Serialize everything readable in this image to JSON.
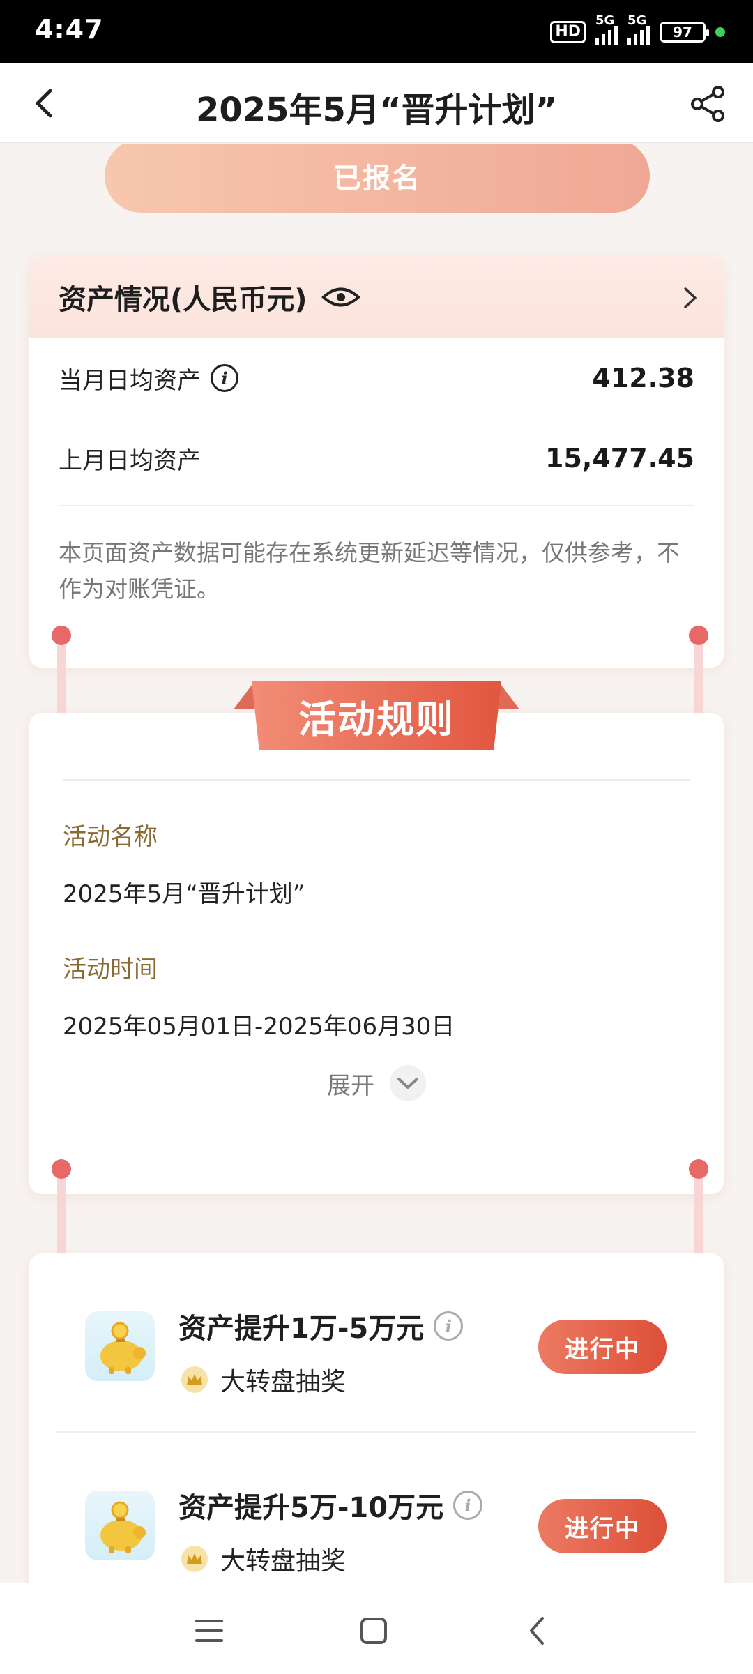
{
  "status_bar": {
    "time": "4:47",
    "hd_label": "HD",
    "signal_label_1": "5G",
    "signal_label_2": "5G",
    "battery": "97"
  },
  "nav": {
    "title": "2025年5月“晋升计划”"
  },
  "enroll_button": {
    "label": "已报名"
  },
  "asset": {
    "title": "资产情况(人民币元)",
    "rows": [
      {
        "label": "当月日均资产",
        "value": "412.38"
      },
      {
        "label": "上月日均资产",
        "value": "15,477.45"
      }
    ],
    "note": "本页面资产数据可能存在系统更新延迟等情况，仅供参考，不作为对账凭证。"
  },
  "rules": {
    "ribbon": "活动规则",
    "name_label": "活动名称",
    "name_value": "2025年5月“晋升计划”",
    "time_label": "活动时间",
    "time_value": "2025年05月01日-2025年06月30日",
    "expand_label": "展开"
  },
  "tasks": [
    {
      "title": "资产提升1万-5万元",
      "reward": "大转盘抽奖",
      "status": "进行中"
    },
    {
      "title": "资产提升5万-10万元",
      "reward": "大转盘抽奖",
      "status": "进行中"
    }
  ],
  "colors": {
    "accent": "#e2563f",
    "enrolled_gradient_start": "#f7c7ae",
    "enrolled_gradient_end": "#f0a895",
    "label_brown": "#8a6a33"
  }
}
